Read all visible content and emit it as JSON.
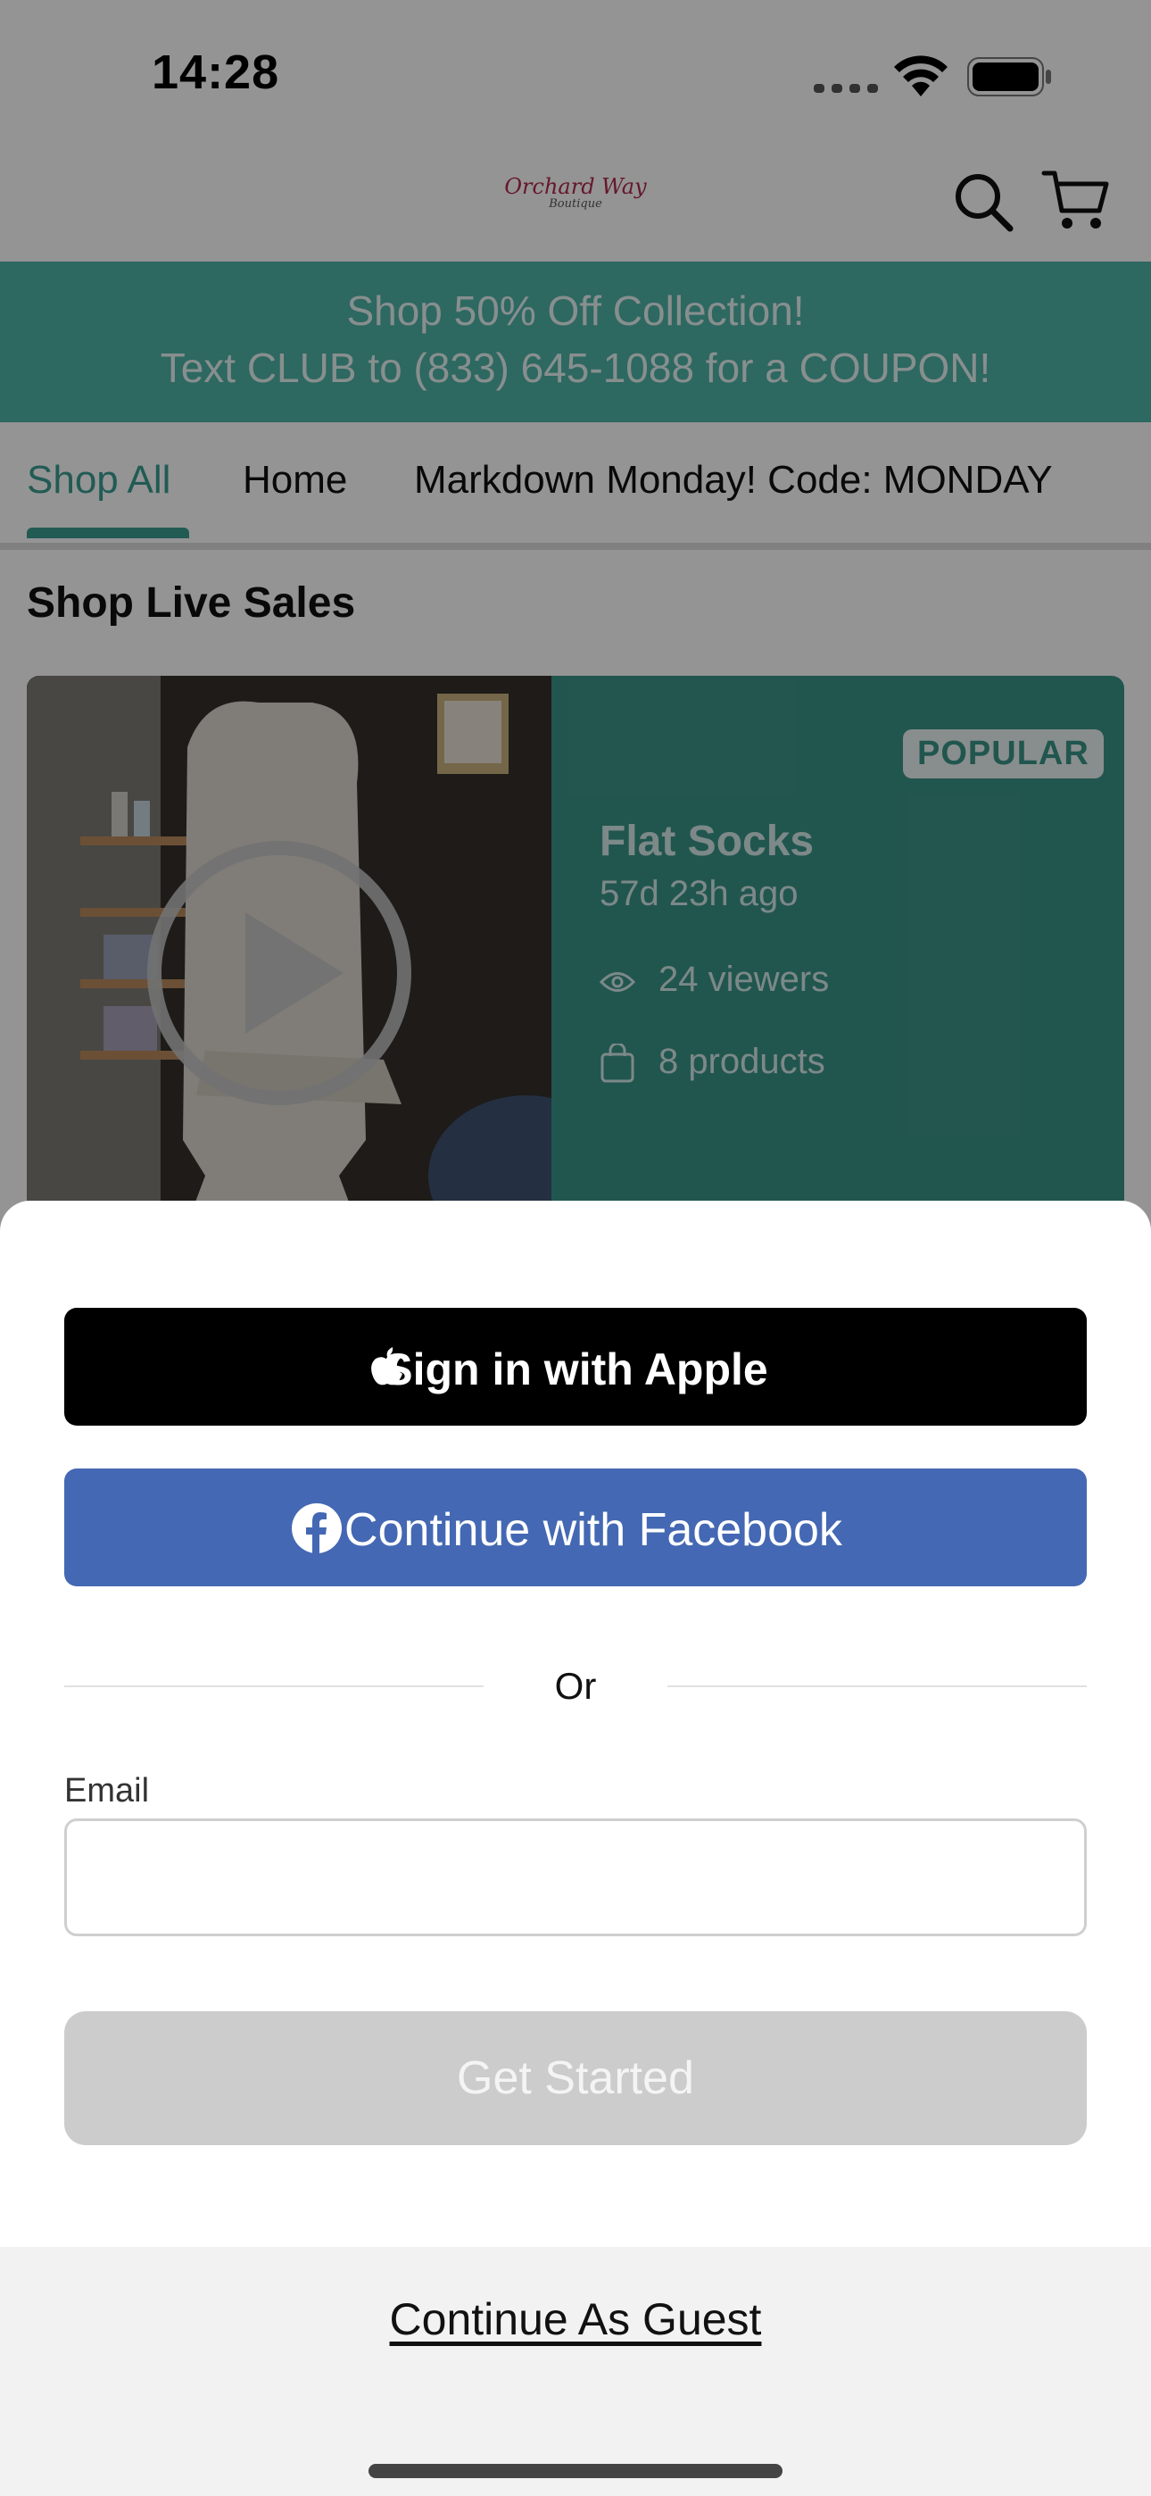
{
  "status_bar": {
    "time": "14:28"
  },
  "header": {
    "logo_line1": "Orchard Way",
    "logo_line2": "Boutique",
    "search_icon": "search-icon",
    "cart_icon": "cart-icon"
  },
  "banner": {
    "line1": "Shop 50% Off Collection!",
    "line2": "Text CLUB to (833) 645-1088 for a COUPON!"
  },
  "nav": {
    "tabs": [
      {
        "label": "Shop All",
        "active": true
      },
      {
        "label": "Home",
        "active": false
      },
      {
        "label": "Markdown Monday! Code: MONDAY",
        "active": false
      }
    ]
  },
  "section": {
    "title": "Shop Live Sales"
  },
  "live_card": {
    "badge": "POPULAR",
    "title": "Flat Socks",
    "time_ago": "57d 23h ago",
    "viewers": "24 viewers",
    "products": "8 products"
  },
  "sheet": {
    "apple_button": "Sign in with Apple",
    "facebook_button": "Continue with Facebook",
    "divider_text": "Or",
    "email_label": "Email",
    "email_value": "",
    "email_placeholder": "",
    "get_started_button": "Get Started",
    "guest_link": "Continue As Guest"
  },
  "colors": {
    "brand_teal": "#4fb3a8",
    "card_teal": "#3a9488",
    "facebook_blue": "#4468b3",
    "apple_black": "#000000",
    "disabled_gray": "#cccccc"
  }
}
